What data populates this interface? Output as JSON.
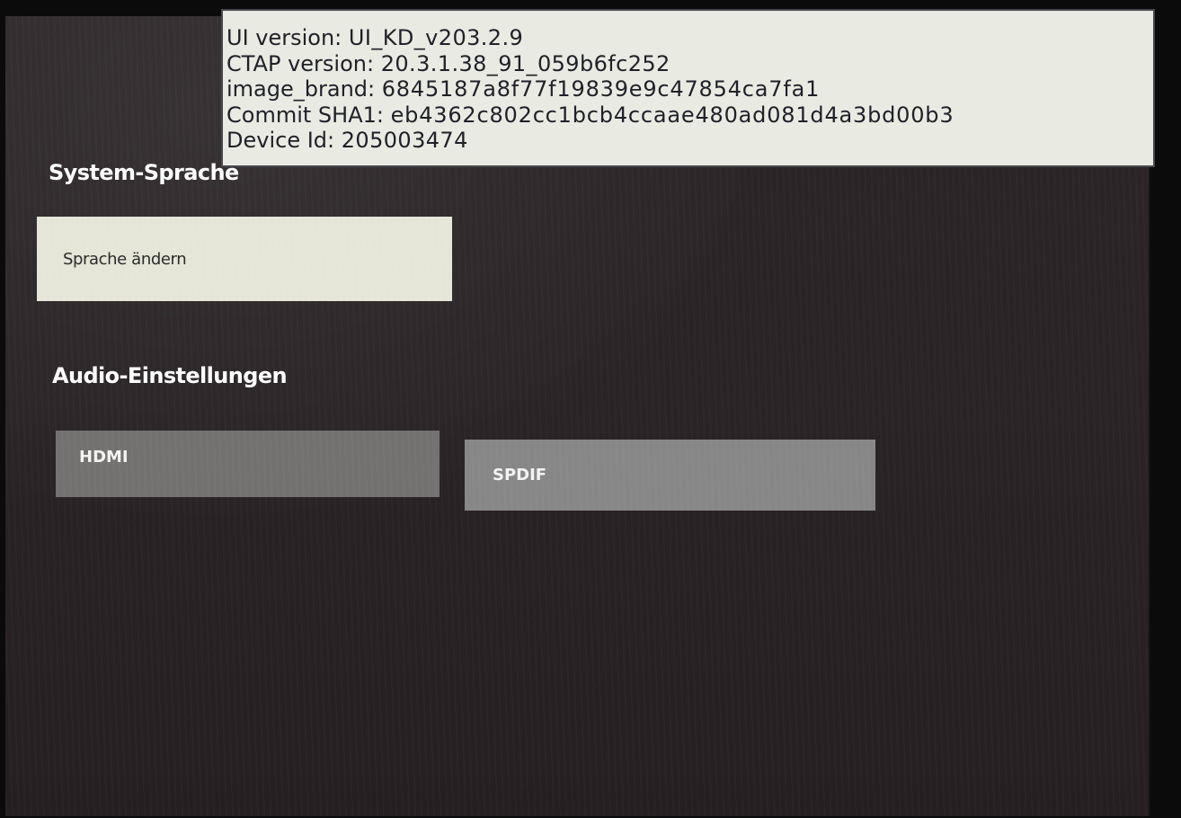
{
  "debug_info": {
    "ui_version": {
      "label": "UI version:",
      "value": "UI_KD_v203.2.9"
    },
    "ctap_version": {
      "label": "CTAP version:",
      "value": "20.3.1.38_91_059b6fc252"
    },
    "image_brand": {
      "label": "image_brand:",
      "value": "6845187a8f77f19839e9c47854ca7fa1"
    },
    "commit_sha1": {
      "label": "Commit SHA1:",
      "value": "eb4362c802cc1bcb4ccaae480ad081d4a3bd00b3"
    },
    "device_id": {
      "label": "Device Id:",
      "value": "205003474"
    }
  },
  "system_language": {
    "title": "System-Sprache",
    "change_button_label": "Sprache ändern"
  },
  "audio_settings": {
    "title": "Audio-Einstellungen",
    "options": [
      {
        "label": "HDMI"
      },
      {
        "label": "SPDIF"
      }
    ]
  },
  "colors": {
    "background": "#2a2426",
    "focused_button": "#e5e5d8",
    "button": "#747270",
    "debug_overlay": "#e9ebe2"
  }
}
